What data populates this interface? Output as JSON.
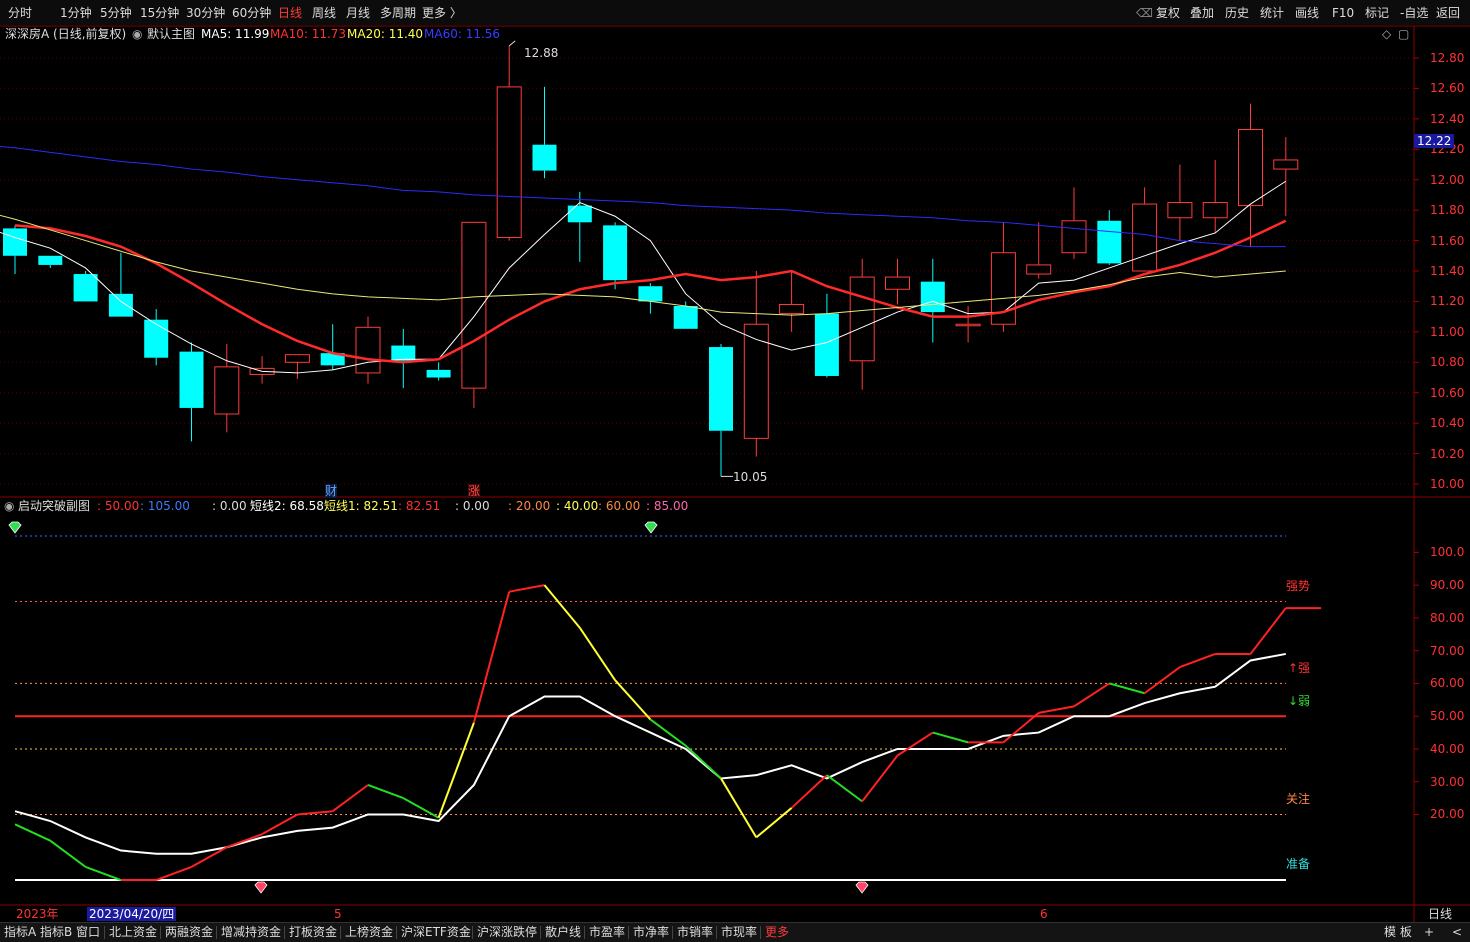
{
  "toolbar": {
    "periods": [
      "分时",
      "1分钟",
      "5分钟",
      "15分钟",
      "30分钟",
      "60分钟",
      "日线",
      "周线",
      "月线",
      "多周期",
      "更多 〉"
    ],
    "active_period": "日线",
    "right": [
      "复权",
      "叠加",
      "历史",
      "统计",
      "画线",
      "F10",
      "标记",
      "-自选",
      "返回"
    ],
    "back_icon": "back-arrow-icon"
  },
  "main_chart": {
    "stock_title": "深深房A (日线,前复权)",
    "template_label": "默认主图",
    "ma5": "MA5: 11.99",
    "ma10": "MA10: 11.73",
    "ma20": "MA20: 11.40",
    "ma60": "MA60: 11.56",
    "high_label": "12.88",
    "low_label": "10.05",
    "current_price": "12.22",
    "marker_cai": "财",
    "marker_zhang": "涨",
    "y_ticks": [
      "12.80",
      "12.60",
      "12.40",
      "12.20",
      "12.00",
      "11.80",
      "11.60",
      "11.40",
      "11.20",
      "11.00",
      "10.80",
      "10.60",
      "10.40",
      "10.20",
      "10.00"
    ]
  },
  "sub_chart": {
    "title": "启动突破副图",
    "levels_a": ": 50.00",
    "levels_b": ": 105.00",
    "val0": ": 0.00",
    "short2": "短线2: 68.58",
    "short1": "短线1: 82.51",
    "short1_val": ": 82.51",
    "val0b": ": 0.00",
    "lvl20": ": 20.00",
    "lvl40": ": 40.00",
    "lvl60": ": 60.00",
    "lvl85": ": 85.00",
    "y_ticks": [
      "100.0",
      "90.00",
      "80.00",
      "70.00",
      "60.00",
      "50.00",
      "40.00",
      "30.00",
      "20.00"
    ],
    "zone_strong": "强势",
    "zone_up": "↑强",
    "zone_down": "↓弱",
    "zone_watch": "关注",
    "zone_ready": "准备"
  },
  "timeline": {
    "year": "2023年",
    "cursor_date": "2023/04/20/四",
    "month5": "5",
    "month6": "6",
    "period": "日线"
  },
  "statusbar": {
    "tabs": [
      "指标A",
      "指标B",
      "窗口",
      "北上资金",
      "两融资金",
      "增减持资金",
      "打板资金",
      "上榜资金",
      "沪深ETF资金",
      "沪深涨跌停",
      "散户线",
      "市盈率",
      "市净率",
      "市销率",
      "市现率",
      "更多"
    ],
    "active_tab": "更多",
    "right": [
      "模 板",
      "+",
      "<"
    ]
  },
  "chart_data": [
    {
      "type": "candlestick",
      "title": "深深房A (日线,前复权)",
      "y_range": [
        10.0,
        12.9
      ],
      "candles": [
        {
          "o": 11.68,
          "h": 11.7,
          "l": 11.38,
          "c": 11.5
        },
        {
          "o": 11.5,
          "h": 11.5,
          "l": 11.42,
          "c": 11.44
        },
        {
          "o": 11.38,
          "h": 11.4,
          "l": 11.2,
          "c": 11.2
        },
        {
          "o": 11.25,
          "h": 11.52,
          "l": 11.1,
          "c": 11.1
        },
        {
          "o": 11.08,
          "h": 11.15,
          "l": 10.78,
          "c": 10.83
        },
        {
          "o": 10.87,
          "h": 10.93,
          "l": 10.28,
          "c": 10.5
        },
        {
          "o": 10.46,
          "h": 10.92,
          "l": 10.34,
          "c": 10.77
        },
        {
          "o": 10.72,
          "h": 10.84,
          "l": 10.66,
          "c": 10.76
        },
        {
          "o": 10.8,
          "h": 10.84,
          "l": 10.69,
          "c": 10.85
        },
        {
          "o": 10.86,
          "h": 11.05,
          "l": 10.75,
          "c": 10.78
        },
        {
          "o": 10.73,
          "h": 11.1,
          "l": 10.66,
          "c": 11.03
        },
        {
          "o": 10.91,
          "h": 11.02,
          "l": 10.63,
          "c": 10.81
        },
        {
          "o": 10.75,
          "h": 10.8,
          "l": 10.68,
          "c": 10.7
        },
        {
          "o": 10.63,
          "h": 11.72,
          "l": 10.5,
          "c": 11.72
        },
        {
          "o": 11.62,
          "h": 12.88,
          "l": 11.6,
          "c": 12.61
        },
        {
          "o": 12.23,
          "h": 12.61,
          "l": 12.01,
          "c": 12.06
        },
        {
          "o": 11.83,
          "h": 11.92,
          "l": 11.46,
          "c": 11.72
        },
        {
          "o": 11.7,
          "h": 11.72,
          "l": 11.28,
          "c": 11.34
        },
        {
          "o": 11.3,
          "h": 11.32,
          "l": 11.12,
          "c": 11.2
        },
        {
          "o": 11.17,
          "h": 11.2,
          "l": 11.02,
          "c": 11.02
        },
        {
          "o": 10.9,
          "h": 10.92,
          "l": 10.05,
          "c": 10.35
        },
        {
          "o": 10.3,
          "h": 11.4,
          "l": 10.18,
          "c": 11.05
        },
        {
          "o": 11.12,
          "h": 11.4,
          "l": 11.0,
          "c": 11.18
        },
        {
          "o": 11.12,
          "h": 11.25,
          "l": 10.7,
          "c": 10.71
        },
        {
          "o": 10.81,
          "h": 11.48,
          "l": 10.62,
          "c": 11.36
        },
        {
          "o": 11.28,
          "h": 11.48,
          "l": 11.18,
          "c": 11.36
        },
        {
          "o": 11.33,
          "h": 11.48,
          "l": 10.93,
          "c": 11.13
        },
        {
          "o": 11.05,
          "h": 11.17,
          "l": 10.93,
          "c": 11.05
        },
        {
          "o": 11.05,
          "h": 11.72,
          "l": 11.0,
          "c": 11.52
        },
        {
          "o": 11.38,
          "h": 11.72,
          "l": 11.35,
          "c": 11.44
        },
        {
          "o": 11.52,
          "h": 11.95,
          "l": 11.48,
          "c": 11.73
        },
        {
          "o": 11.73,
          "h": 11.8,
          "l": 11.44,
          "c": 11.45
        },
        {
          "o": 11.4,
          "h": 11.95,
          "l": 11.4,
          "c": 11.84
        },
        {
          "o": 11.75,
          "h": 12.1,
          "l": 11.6,
          "c": 11.85
        },
        {
          "o": 11.75,
          "h": 12.13,
          "l": 11.65,
          "c": 11.85
        },
        {
          "o": 11.83,
          "h": 12.5,
          "l": 11.56,
          "c": 12.33
        },
        {
          "o": 12.07,
          "h": 12.28,
          "l": 11.76,
          "c": 12.13
        }
      ],
      "series": [
        {
          "name": "MA5",
          "color": "#ffffff",
          "values": [
            11.7,
            11.62,
            11.55,
            11.42,
            11.2,
            11.05,
            10.92,
            10.81,
            10.74,
            10.73,
            10.75,
            10.8,
            10.82,
            10.82,
            11.1,
            11.42,
            11.64,
            11.85,
            11.76,
            11.6,
            11.25,
            11.05,
            10.95,
            10.88,
            10.93,
            11.03,
            11.13,
            11.2,
            11.12,
            11.13,
            11.32,
            11.34,
            11.42,
            11.5,
            11.58,
            11.65,
            11.84,
            11.99
          ]
        },
        {
          "name": "MA10",
          "color": "#ff2a2a",
          "values": [
            11.7,
            11.68,
            11.63,
            11.56,
            11.45,
            11.32,
            11.18,
            11.05,
            10.94,
            10.86,
            10.82,
            10.8,
            10.82,
            10.94,
            11.08,
            11.2,
            11.28,
            11.32,
            11.34,
            11.38,
            11.34,
            11.36,
            11.4,
            11.3,
            11.23,
            11.16,
            11.1,
            11.1,
            11.13,
            11.21,
            11.26,
            11.3,
            11.38,
            11.44,
            11.52,
            11.62,
            11.73
          ]
        },
        {
          "name": "MA20",
          "color": "#e8e87a",
          "values": [
            11.88,
            11.8,
            11.74,
            11.67,
            11.6,
            11.53,
            11.46,
            11.4,
            11.36,
            11.32,
            11.28,
            11.25,
            11.23,
            11.22,
            11.21,
            11.23,
            11.24,
            11.25,
            11.24,
            11.23,
            11.2,
            11.17,
            11.13,
            11.12,
            11.11,
            11.12,
            11.14,
            11.16,
            11.18,
            11.2,
            11.22,
            11.24,
            11.27,
            11.31,
            11.36,
            11.39,
            11.36,
            11.38,
            11.4
          ]
        },
        {
          "name": "MA60",
          "color": "#2b2bff",
          "values": [
            12.26,
            12.23,
            12.21,
            12.18,
            12.15,
            12.12,
            12.1,
            12.07,
            12.05,
            12.02,
            12.0,
            11.98,
            11.96,
            11.93,
            11.92,
            11.9,
            11.89,
            11.88,
            11.87,
            11.86,
            11.85,
            11.83,
            11.82,
            11.81,
            11.8,
            11.78,
            11.77,
            11.76,
            11.75,
            11.73,
            11.72,
            11.7,
            11.68,
            11.66,
            11.64,
            11.6,
            11.58,
            11.56,
            11.56
          ]
        }
      ]
    },
    {
      "type": "line",
      "title": "启动突破副图",
      "y_range": [
        0,
        105
      ],
      "x_count": 37,
      "series": [
        {
          "name": "短线1",
          "values": [
            17,
            12,
            4,
            0,
            0,
            4,
            10,
            14,
            20,
            21,
            29,
            25,
            19,
            48,
            88,
            90,
            77,
            61,
            49,
            41,
            31,
            13,
            22,
            32,
            24,
            38,
            45,
            42,
            42,
            51,
            53,
            60,
            57,
            65,
            69,
            69,
            83,
            83
          ]
        },
        {
          "name": "短线2",
          "values": [
            21,
            18,
            13,
            9,
            8,
            8,
            10,
            13,
            15,
            16,
            20,
            20,
            18,
            29,
            50,
            56,
            56,
            50,
            45,
            40,
            31,
            32,
            35,
            31,
            36,
            40,
            40,
            40,
            44,
            45,
            50,
            50,
            54,
            57,
            59,
            67,
            69
          ]
        }
      ],
      "reference_levels": [
        20,
        40,
        50,
        60,
        85,
        105
      ]
    }
  ]
}
